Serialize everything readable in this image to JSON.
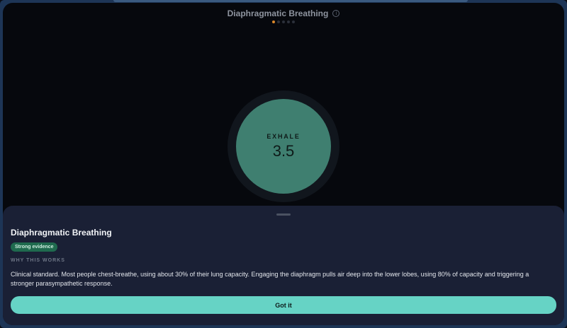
{
  "header": {
    "title": "Diaphragmatic Breathing",
    "info_icon": "info-icon",
    "page_dots": {
      "count": 5,
      "active_index": 0
    }
  },
  "breath": {
    "phase": "EXHALE",
    "seconds": "3.5",
    "orb_color": "#3f7f70"
  },
  "sheet": {
    "title": "Diaphragmatic Breathing",
    "badge": "Strong evidence",
    "section_label": "WHY THIS WORKS",
    "body": "Clinical standard. Most people chest-breathe, using about 30% of their lung capacity. Engaging the diaphragm pulls air deep into the lower lobes, using 80% of capacity and triggering a stronger parasympathetic response.",
    "button_label": "Got it"
  },
  "colors": {
    "accent": "#66d3c5",
    "badge_bg": "#1f6a4e",
    "active_dot": "#d9872a",
    "sheet_bg": "#1a2035"
  }
}
